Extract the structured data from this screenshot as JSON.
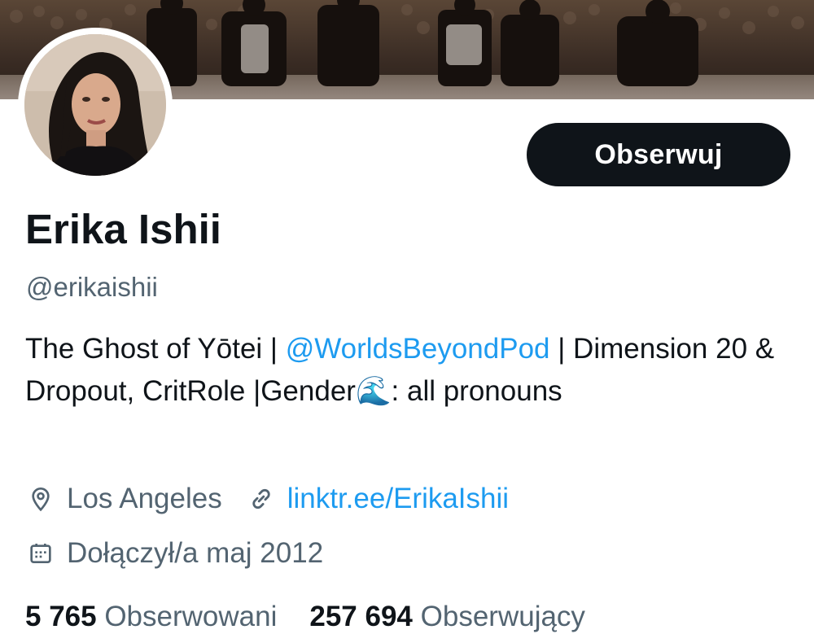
{
  "profile": {
    "display_name": "Erika Ishii",
    "handle": "@erikaishii",
    "follow_label": "Obserwuj"
  },
  "bio": {
    "part1": "The Ghost of Yōtei | ",
    "mention": "@WorldsBeyondPod",
    "part2": " | Dimension 20 & Dropout, CritRole |Gender",
    "emoji": "🌊",
    "part3": ": all pronouns"
  },
  "meta": {
    "location_icon": "location-pin-icon",
    "location": "Los Angeles",
    "link_icon": "link-icon",
    "website": "linktr.ee/ErikaIshii",
    "joined_icon": "calendar-icon",
    "joined": "Dołączył/a maj 2012"
  },
  "stats": {
    "following_count": "5 765",
    "following_label": "Obserwowani",
    "followers_count": "257 694",
    "followers_label": "Obserwujący"
  },
  "colors": {
    "accent": "#1d9bf0",
    "text_primary": "#0f1419",
    "text_secondary": "#536471",
    "button_bg": "#0f1419"
  }
}
